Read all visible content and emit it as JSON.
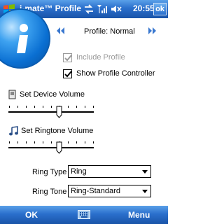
{
  "title_bar": {
    "app_title": "i-mate™ Profile",
    "clock": "20:55",
    "ok_label": "ok",
    "icons": [
      "windows-start-icon",
      "connectivity-arrows-icon",
      "signal-strength-icon",
      "speaker-mute-icon"
    ]
  },
  "logo": {
    "icon": "imate-badge-logo"
  },
  "profile": {
    "label": "Profile: Normal",
    "prev_icon": "double-chevron-left-icon",
    "next_icon": "double-chevron-right-icon"
  },
  "options": {
    "include_profile": {
      "label": "Include Profile",
      "checked": true,
      "enabled": false
    },
    "show_controller": {
      "label": "Show Profile Controller",
      "checked": true,
      "enabled": true
    }
  },
  "device_volume": {
    "label": "Set Device Volume",
    "icon": "device-volume-icon",
    "value_fraction": 0.6
  },
  "ringtone_volume": {
    "label": "Set Ringtone Volume",
    "icon": "music-note-icon",
    "value_fraction": 0.6
  },
  "ring_type": {
    "label": "Ring Type",
    "value": "Ring"
  },
  "ring_tone": {
    "label": "Ring Tone",
    "value": "Ring-Standard"
  },
  "softkeys": {
    "left": "OK",
    "right": "Menu",
    "center_icon": "keyboard-icon"
  },
  "colors": {
    "title_bar": "#2a6fcc",
    "badge": "#0a6fd2"
  }
}
